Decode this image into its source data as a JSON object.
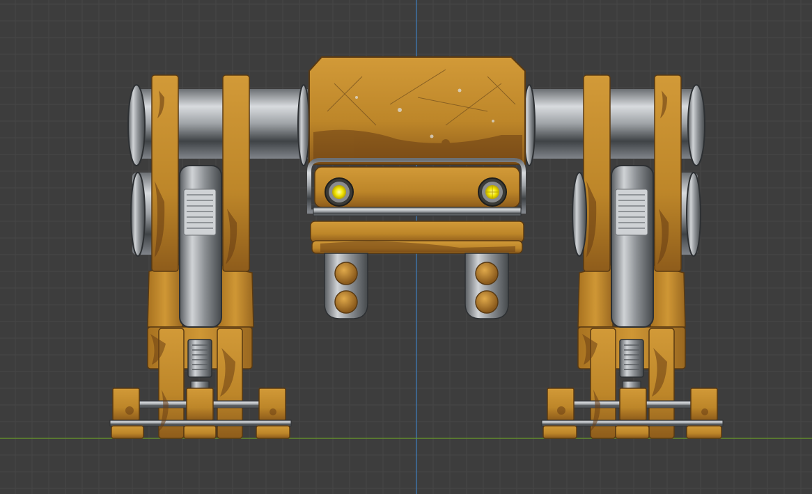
{
  "viewport": {
    "view": "front-orthographic",
    "background_color": "#3d3d3d",
    "grid_minor_color": "#474747",
    "grid_major_color": "#525252",
    "vertical_axis_color": "#3f7fbf",
    "horizontal_axis_color": "#6a9a2a"
  },
  "model": {
    "subject": "walker-mech",
    "paint_color": "#c8922f",
    "paint_dark_color": "#8a5a1c",
    "rust_color": "#6b3f14",
    "metal_color": "#b8bcc0",
    "metal_dark_color": "#55595d",
    "eye_color": "#f2e600",
    "eye_count": 2,
    "leg_count": 2
  }
}
